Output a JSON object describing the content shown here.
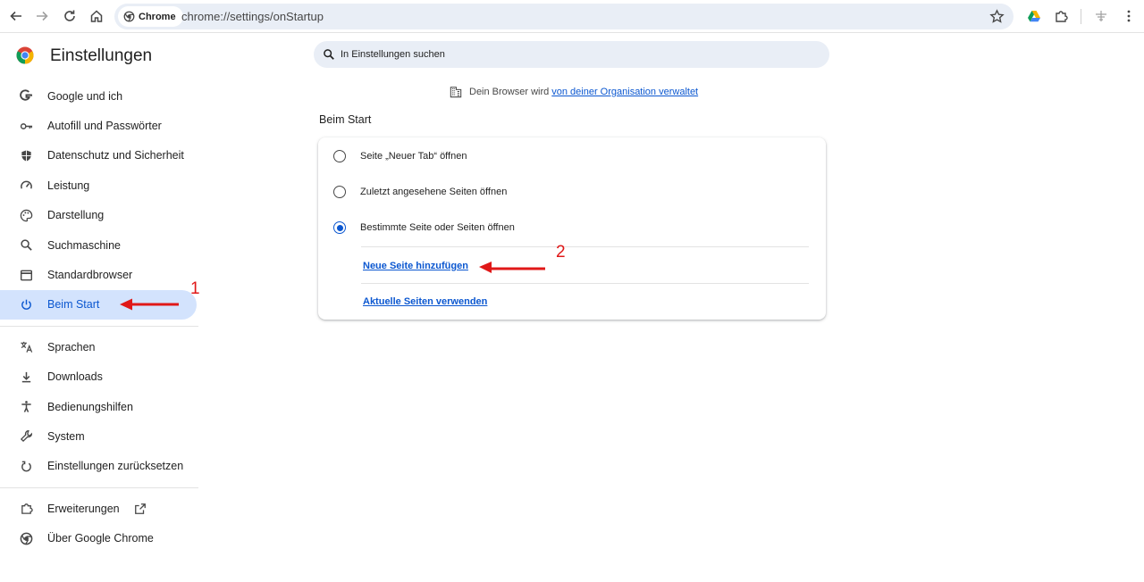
{
  "browser": {
    "chip_label": "Chrome",
    "url": "chrome://settings/onStartup"
  },
  "sidebar": {
    "title": "Einstellungen",
    "items": [
      {
        "label": "Google und ich",
        "icon": "google-icon"
      },
      {
        "label": "Autofill und Passwörter",
        "icon": "key-icon"
      },
      {
        "label": "Datenschutz und Sicherheit",
        "icon": "shield-icon"
      },
      {
        "label": "Leistung",
        "icon": "speedometer-icon"
      },
      {
        "label": "Darstellung",
        "icon": "palette-icon"
      },
      {
        "label": "Suchmaschine",
        "icon": "search-icon"
      },
      {
        "label": "Standardbrowser",
        "icon": "browser-window-icon"
      },
      {
        "label": "Beim Start",
        "icon": "power-icon",
        "active": true
      }
    ],
    "items2": [
      {
        "label": "Sprachen",
        "icon": "translate-icon"
      },
      {
        "label": "Downloads",
        "icon": "download-icon"
      },
      {
        "label": "Bedienungshilfen",
        "icon": "accessibility-icon"
      },
      {
        "label": "System",
        "icon": "wrench-icon"
      },
      {
        "label": "Einstellungen zurücksetzen",
        "icon": "reset-icon"
      }
    ],
    "items3": [
      {
        "label": "Erweiterungen",
        "icon": "puzzle-icon"
      },
      {
        "label": "Über Google Chrome",
        "icon": "chrome-icon"
      }
    ]
  },
  "search": {
    "placeholder": "In Einstellungen suchen"
  },
  "managed": {
    "text": "Dein Browser wird",
    "link": "von deiner Organisation verwaltet"
  },
  "startup": {
    "section_title": "Beim Start",
    "options": [
      {
        "label": "Seite „Neuer Tab“ öffnen",
        "checked": false
      },
      {
        "label": "Zuletzt angesehene Seiten öffnen",
        "checked": false
      },
      {
        "label": "Bestimmte Seite oder Seiten öffnen",
        "checked": true
      }
    ],
    "add_page_link": "Neue Seite hinzufügen",
    "use_current_link": "Aktuelle Seiten verwenden"
  },
  "annotations": {
    "marker_1": "1",
    "marker_2": "2",
    "color": "#e01818"
  },
  "colors": {
    "accent": "#0b57d0",
    "active_bg": "#d3e3fd"
  }
}
